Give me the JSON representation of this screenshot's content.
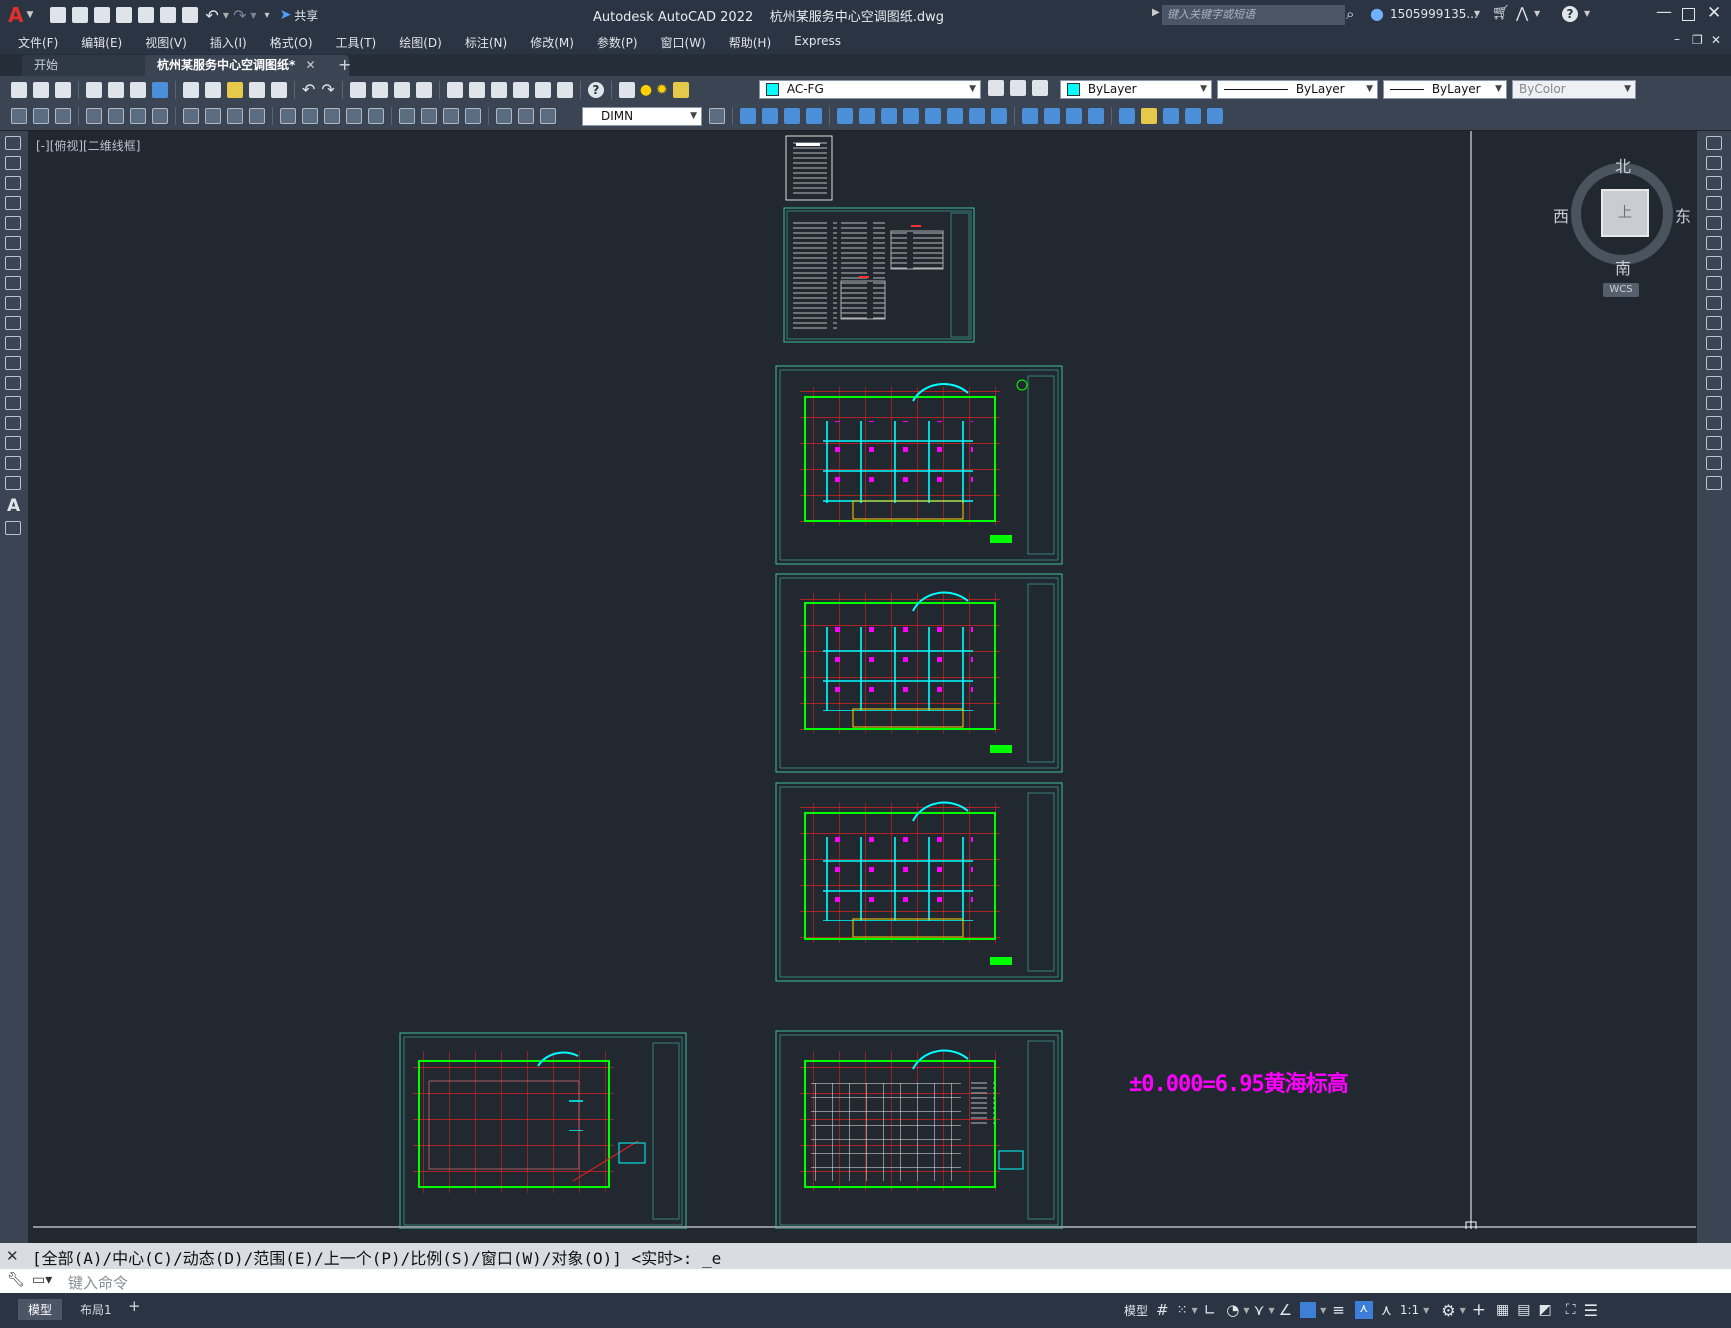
{
  "app": {
    "title": "Autodesk AutoCAD 2022    杭州某服务中心空调图纸.dwg",
    "logo": "A",
    "share_label": "共享",
    "search_placeholder": "键入关键字或短语",
    "user": "1505999135...",
    "help": "?"
  },
  "menu": [
    "文件(F)",
    "编辑(E)",
    "视图(V)",
    "插入(I)",
    "格式(O)",
    "工具(T)",
    "绘图(D)",
    "标注(N)",
    "修改(M)",
    "参数(P)",
    "窗口(W)",
    "帮助(H)",
    "Express"
  ],
  "tabs": {
    "start": "开始",
    "drawing": "杭州某服务中心空调图纸*",
    "close": "✕",
    "add": "+"
  },
  "toolbar": {
    "layer": "AC-FG",
    "color": "ByLayer",
    "linetype": "ByLayer",
    "lineweight": "ByLayer",
    "plotstyle": "ByColor",
    "dimstyle": "DIMN"
  },
  "viewport": {
    "label": "[-][俯视][二维线框]",
    "elevation_note": "±0.000=6.95黄海标高"
  },
  "viewcube": {
    "north": "北",
    "south": "南",
    "east": "东",
    "west": "西",
    "face": "上",
    "wcs": "WCS"
  },
  "command": {
    "history": "[全部(A)/中心(C)/动态(D)/范围(E)/上一个(P)/比例(S)/窗口(W)/对象(O)] <实时>: _e",
    "placeholder": "键入命令"
  },
  "status": {
    "model_tab": "模型",
    "layout_tab": "布局1",
    "add_tab": "+",
    "model_label": "模型",
    "scale": "1:1"
  },
  "colors": {
    "canvas": "#212830",
    "chrome": "#2b3442",
    "toolbar": "#3a4453",
    "frame": "#4fd6b0",
    "grid_green": "#00ff00",
    "grid_red": "#ff2020",
    "duct_cyan": "#00ffff",
    "magenta": "#ff00ff",
    "yellow": "#ffd000"
  }
}
